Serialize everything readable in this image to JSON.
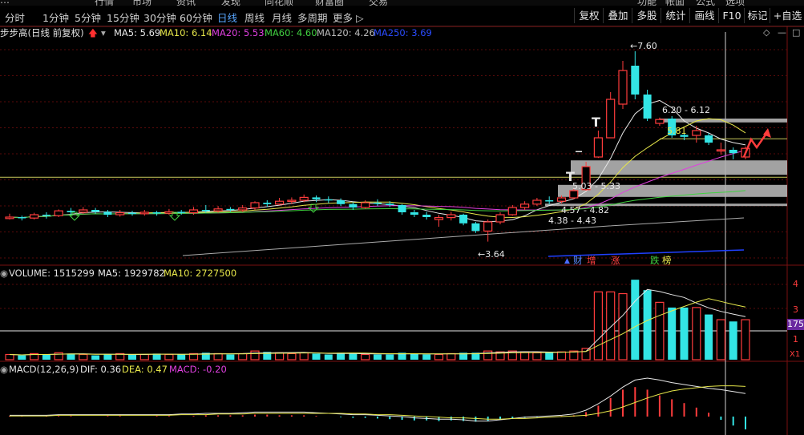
{
  "top_menu": [
    "…",
    "行情",
    "市场",
    "资讯",
    "发现",
    "同花顺",
    "财富圈",
    "交易",
    "功能",
    "帐面",
    "公式",
    "选项"
  ],
  "toolbar": {
    "tabs": [
      "分时",
      "1分钟",
      "5分钟",
      "15分钟",
      "30分钟",
      "60分钟",
      "日线",
      "周线",
      "月线",
      "多周期",
      "更多 ▷"
    ],
    "active_tab": "日线",
    "buttons": [
      "复权",
      "叠加",
      "多股",
      "统计",
      "画线",
      "F10",
      "标记",
      "+自选"
    ]
  },
  "price_header": {
    "title": "步步高(日线 前复权)",
    "ma5": "MA5: 5.69",
    "ma10": "MA10: 6.14",
    "ma20": "MA20: 5.53",
    "ma60": "MA60: 4.60",
    "ma120": "MA120: 4.26",
    "ma250": "MA250: 3.69"
  },
  "annotations": {
    "high": "7.60",
    "low": "3.64",
    "gap1": "6.20 - 6.12",
    "mark_581": "5.81",
    "gap2": "5.03 - 5.33",
    "gap3": "4.57 - 4.82",
    "gap4": "4.38 - 4.43"
  },
  "event_tags": [
    "财",
    "增",
    "涨",
    "跌",
    "榜"
  ],
  "volume_header": {
    "title": "VOLUME: 1515299",
    "ma5": "MA5: 1929782",
    "ma10": "MA10: 2727500"
  },
  "volume_axis": {
    "tick_4": "4",
    "tick_3": "3",
    "tick_1": "1",
    "badge": "175",
    "unit": "X1"
  },
  "macd_header": {
    "title": "MACD(12,26,9)",
    "dif": "DIF: 0.36",
    "dea": "DEA: 0.47",
    "macd": "MACD: -0.20"
  },
  "colors": {
    "up": "#ff3c3c",
    "down": "#33e5e5",
    "ma5": "#e8e8e8",
    "ma10": "#e6e64a",
    "ma20": "#e040e0",
    "ma60": "#40d040",
    "ma120": "#aaaaaa",
    "ma250": "#2040ff"
  },
  "chart_data": {
    "type": "candlestick",
    "price_range": [
      3.3,
      7.9
    ],
    "candles": [
      [
        4.12,
        4.15,
        4.22,
        4.1
      ],
      [
        4.15,
        4.13,
        4.18,
        4.08
      ],
      [
        4.13,
        4.2,
        4.24,
        4.1
      ],
      [
        4.2,
        4.18,
        4.25,
        4.12
      ],
      [
        4.18,
        4.28,
        4.31,
        4.15
      ],
      [
        4.28,
        4.25,
        4.34,
        4.2
      ],
      [
        4.25,
        4.3,
        4.36,
        4.22
      ],
      [
        4.3,
        4.26,
        4.34,
        4.22
      ],
      [
        4.26,
        4.2,
        4.3,
        4.15
      ],
      [
        4.2,
        4.24,
        4.3,
        4.16
      ],
      [
        4.24,
        4.22,
        4.28,
        4.18
      ],
      [
        4.22,
        4.25,
        4.3,
        4.18
      ],
      [
        4.25,
        4.23,
        4.28,
        4.18
      ],
      [
        4.23,
        4.26,
        4.32,
        4.2
      ],
      [
        4.26,
        4.24,
        4.3,
        4.2
      ],
      [
        4.24,
        4.3,
        4.36,
        4.2
      ],
      [
        4.3,
        4.28,
        4.4,
        4.24
      ],
      [
        4.28,
        4.32,
        4.38,
        4.24
      ],
      [
        4.32,
        4.3,
        4.36,
        4.26
      ],
      [
        4.3,
        4.34,
        4.4,
        4.26
      ],
      [
        4.34,
        4.45,
        4.48,
        4.3
      ],
      [
        4.45,
        4.42,
        4.5,
        4.36
      ],
      [
        4.42,
        4.48,
        4.55,
        4.4
      ],
      [
        4.48,
        4.5,
        4.56,
        4.42
      ],
      [
        4.5,
        4.56,
        4.62,
        4.46
      ],
      [
        4.56,
        4.52,
        4.6,
        4.46
      ],
      [
        4.52,
        4.5,
        4.58,
        4.44
      ],
      [
        4.5,
        4.42,
        4.54,
        4.38
      ],
      [
        4.42,
        4.35,
        4.46,
        4.3
      ],
      [
        4.35,
        4.45,
        4.5,
        4.32
      ],
      [
        4.45,
        4.43,
        4.52,
        4.38
      ],
      [
        4.43,
        4.4,
        4.48,
        4.36
      ],
      [
        4.4,
        4.25,
        4.42,
        4.2
      ],
      [
        4.25,
        4.2,
        4.3,
        4.15
      ],
      [
        4.2,
        4.15,
        4.26,
        4.1
      ],
      [
        4.1,
        4.14,
        4.2,
        3.95
      ],
      [
        4.14,
        4.2,
        4.26,
        4.08
      ],
      [
        4.2,
        4.02,
        4.22,
        3.98
      ],
      [
        4.02,
        3.86,
        4.05,
        3.82
      ],
      [
        3.86,
        4.05,
        4.1,
        3.64
      ],
      [
        4.05,
        4.2,
        4.25,
        4.0
      ],
      [
        4.2,
        4.35,
        4.4,
        4.18
      ],
      [
        4.35,
        4.42,
        4.48,
        4.3
      ],
      [
        4.42,
        4.5,
        4.55,
        4.38
      ],
      [
        4.5,
        4.48,
        4.58,
        4.42
      ],
      [
        4.48,
        4.55,
        4.6,
        4.44
      ],
      [
        4.55,
        4.7,
        4.74,
        4.52
      ],
      [
        4.72,
        5.2,
        5.3,
        4.7
      ],
      [
        5.4,
        5.8,
        5.95,
        5.38
      ],
      [
        5.8,
        6.6,
        6.75,
        5.8
      ],
      [
        6.5,
        7.2,
        7.4,
        6.4
      ],
      [
        7.3,
        6.7,
        7.6,
        6.6
      ],
      [
        6.7,
        6.2,
        6.8,
        6.15
      ],
      [
        6.1,
        6.18,
        6.22,
        6.05
      ],
      [
        6.2,
        5.85,
        6.25,
        5.8
      ],
      [
        5.86,
        5.82,
        5.9,
        5.75
      ],
      [
        5.85,
        5.95,
        6.05,
        5.7
      ],
      [
        5.85,
        5.7,
        5.9,
        5.65
      ],
      [
        5.55,
        5.55,
        5.7,
        5.45
      ],
      [
        5.55,
        5.48,
        5.6,
        5.35
      ],
      [
        5.4,
        5.58,
        5.62,
        5.35
      ]
    ],
    "volume_range": [
      0,
      4.7
    ],
    "volume": [
      0.3,
      0.25,
      0.35,
      0.3,
      0.4,
      0.35,
      0.3,
      0.25,
      0.3,
      0.35,
      0.3,
      0.3,
      0.35,
      0.3,
      0.3,
      0.35,
      0.4,
      0.35,
      0.3,
      0.35,
      0.5,
      0.45,
      0.4,
      0.35,
      0.4,
      0.35,
      0.3,
      0.4,
      0.35,
      0.3,
      0.3,
      0.3,
      0.4,
      0.35,
      0.3,
      0.3,
      0.35,
      0.4,
      0.4,
      0.5,
      0.45,
      0.5,
      0.45,
      0.4,
      0.4,
      0.45,
      0.5,
      0.65,
      3.9,
      3.9,
      3.8,
      4.6,
      4.0,
      3.3,
      3.0,
      3.0,
      3.0,
      2.6,
      2.3,
      2.2,
      2.3
    ],
    "macd_range": [
      -0.25,
      0.65
    ],
    "macd": [
      0.01,
      0.01,
      0.0,
      0.01,
      0.01,
      0.01,
      0.0,
      0.0,
      0.01,
      0.01,
      0.0,
      0.0,
      0.01,
      0.01,
      0.0,
      0.01,
      0.02,
      0.02,
      0.02,
      0.02,
      0.03,
      0.03,
      0.02,
      0.02,
      0.02,
      0.01,
      0.0,
      -0.01,
      -0.02,
      -0.02,
      -0.03,
      -0.04,
      -0.05,
      -0.06,
      -0.06,
      -0.07,
      -0.06,
      -0.07,
      -0.08,
      -0.07,
      -0.05,
      -0.03,
      -0.02,
      -0.01,
      0.0,
      0.01,
      0.02,
      0.07,
      0.17,
      0.29,
      0.42,
      0.46,
      0.42,
      0.33,
      0.27,
      0.21,
      0.14,
      0.06,
      -0.05,
      -0.14,
      -0.2
    ],
    "dif_range": [
      -0.1,
      0.65
    ],
    "dif": [
      0.02,
      0.02,
      0.02,
      0.02,
      0.03,
      0.03,
      0.03,
      0.03,
      0.03,
      0.03,
      0.03,
      0.03,
      0.03,
      0.03,
      0.04,
      0.04,
      0.05,
      0.05,
      0.05,
      0.06,
      0.07,
      0.07,
      0.07,
      0.07,
      0.07,
      0.06,
      0.05,
      0.04,
      0.03,
      0.03,
      0.02,
      0.01,
      0.0,
      -0.02,
      -0.03,
      -0.04,
      -0.04,
      -0.05,
      -0.07,
      -0.07,
      -0.05,
      -0.03,
      -0.01,
      0.0,
      0.01,
      0.02,
      0.04,
      0.1,
      0.2,
      0.32,
      0.46,
      0.57,
      0.6,
      0.57,
      0.53,
      0.5,
      0.47,
      0.44,
      0.42,
      0.39,
      0.36
    ],
    "dea": [
      0.01,
      0.01,
      0.01,
      0.01,
      0.02,
      0.02,
      0.02,
      0.02,
      0.02,
      0.02,
      0.02,
      0.02,
      0.02,
      0.02,
      0.03,
      0.03,
      0.03,
      0.04,
      0.04,
      0.04,
      0.05,
      0.05,
      0.05,
      0.05,
      0.05,
      0.05,
      0.05,
      0.05,
      0.04,
      0.04,
      0.03,
      0.03,
      0.02,
      0.01,
      0.0,
      -0.01,
      -0.02,
      -0.02,
      -0.03,
      -0.04,
      -0.04,
      -0.03,
      -0.03,
      -0.02,
      -0.01,
      0.0,
      0.01,
      0.02,
      0.05,
      0.09,
      0.15,
      0.22,
      0.29,
      0.35,
      0.4,
      0.43,
      0.45,
      0.47,
      0.48,
      0.48,
      0.47
    ]
  }
}
